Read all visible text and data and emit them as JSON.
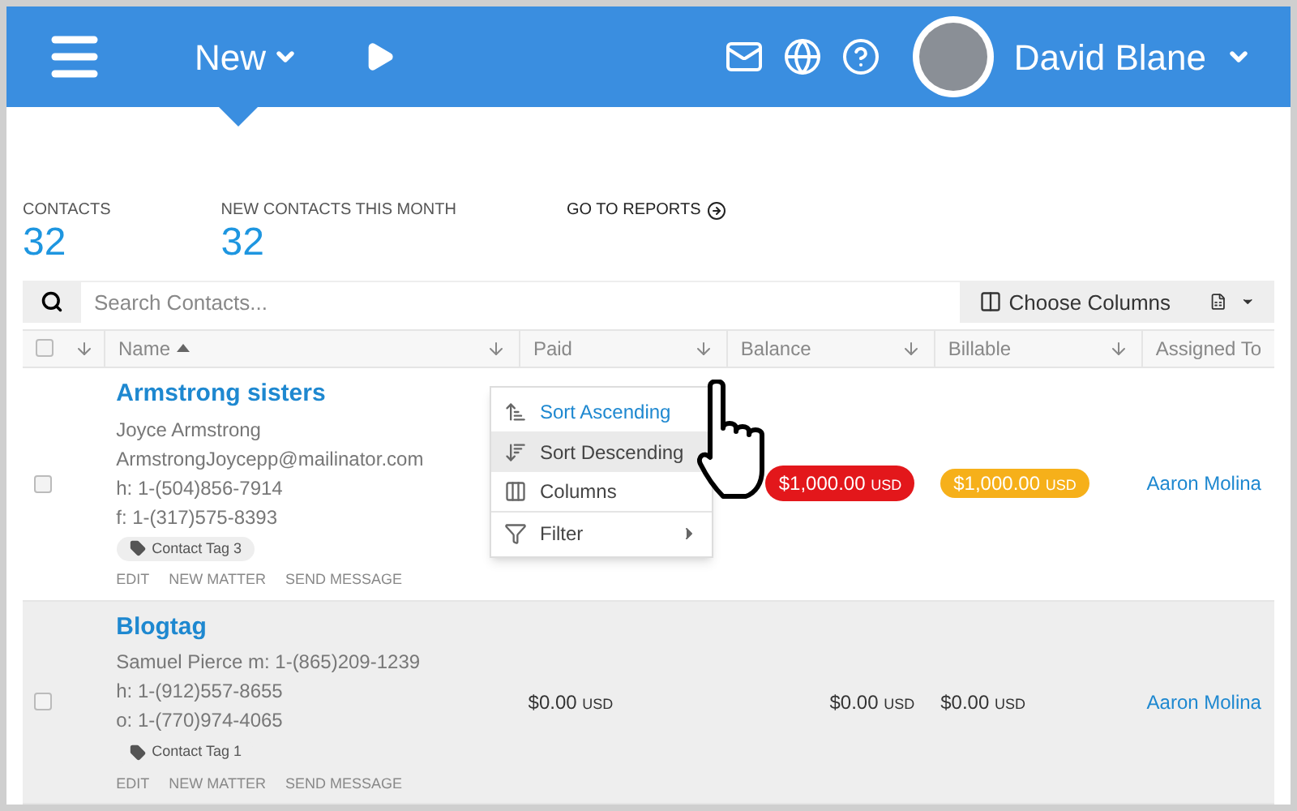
{
  "header": {
    "new_label": "New",
    "user_name": "David Blane"
  },
  "stats": [
    {
      "label": "CONTACTS",
      "value": "32"
    },
    {
      "label": "NEW CONTACTS THIS MONTH",
      "value": "32"
    }
  ],
  "reports_link": "GO TO REPORTS",
  "search": {
    "placeholder": "Search Contacts..."
  },
  "choose_columns": "Choose Columns",
  "table": {
    "select_all": {
      "checked": false
    },
    "columns": [
      {
        "label": "Name",
        "sorted": true
      },
      {
        "label": "Paid",
        "sorted": false
      },
      {
        "label": "Balance",
        "sorted": false
      },
      {
        "label": "Billable",
        "sorted": false
      },
      {
        "label": "Assigned To",
        "sorted": false
      }
    ],
    "rows": [
      {
        "name": "Armstrong sisters",
        "checked": false,
        "highlighted": false,
        "details": [
          "Joyce Armstrong",
          "ArmstrongJoycepp@mailinator.com",
          "h: 1-(504)856-7914",
          "f: 1-(317)575-8393"
        ],
        "tag": "Contact Tag 3",
        "actions": [
          "EDIT",
          "NEW MATTER",
          "SEND MESSAGE"
        ],
        "balance": {
          "amount": "$1,000.00",
          "currency": "USD",
          "kind": "danger"
        },
        "billable": {
          "amount": "$1,000.00",
          "currency": "USD",
          "kind": "warning"
        },
        "assigned_to": "Aaron Molina"
      },
      {
        "name": "Blogtag",
        "checked": false,
        "highlighted": true,
        "details": [
          "Samuel Pierce m: 1-(865)209-1239",
          "h: 1-(912)557-8655",
          "o: 1-(770)974-4065"
        ],
        "tag": "Contact Tag 1",
        "actions": [
          "EDIT",
          "NEW MATTER",
          "SEND MESSAGE"
        ],
        "paid": {
          "amount": "$0.00",
          "currency": "USD",
          "kind": "plain"
        },
        "balance": {
          "amount": "$0.00",
          "currency": "USD",
          "kind": "plain"
        },
        "billable": {
          "amount": "$0.00",
          "currency": "USD",
          "kind": "plain"
        },
        "assigned_to": "Aaron Molina"
      }
    ]
  },
  "column_menu": [
    {
      "label": "Sort Ascending",
      "kind": "sort-asc",
      "active": true,
      "hovered": false,
      "submenu": false
    },
    {
      "label": "Sort Descending",
      "kind": "sort-desc",
      "active": false,
      "hovered": true,
      "submenu": false
    },
    {
      "label": "Columns",
      "kind": "columns",
      "active": false,
      "hovered": false,
      "submenu": false
    },
    {
      "label": "Filter",
      "kind": "filter",
      "active": false,
      "hovered": false,
      "submenu": true
    }
  ]
}
